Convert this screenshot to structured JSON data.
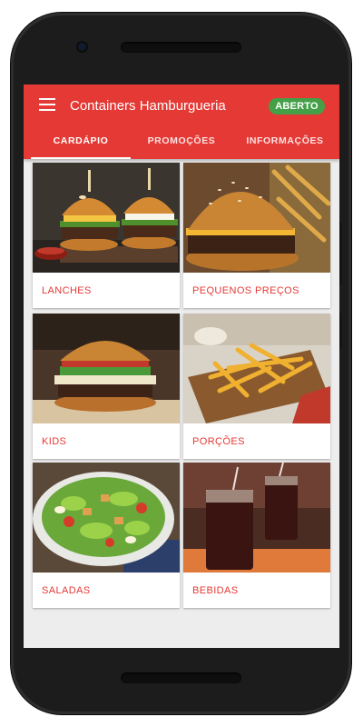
{
  "appbar": {
    "title": "Containers Hamburgueria",
    "status_badge": "ABERTO",
    "accent": "#e53935",
    "badge_color": "#43a047",
    "menu_icon": "hamburger-menu-icon"
  },
  "tabs": [
    {
      "label": "CARDÁPIO",
      "active": true
    },
    {
      "label": "PROMOÇÕES",
      "active": false
    },
    {
      "label": "INFORMAÇÕES",
      "active": false
    }
  ],
  "categories": [
    {
      "label": "LANCHES",
      "image": "burgers-photo"
    },
    {
      "label": "PEQUENOS PREÇOS",
      "image": "small-burger-photo"
    },
    {
      "label": "KIDS",
      "image": "kids-burger-photo"
    },
    {
      "label": "PORÇÕES",
      "image": "fries-photo"
    },
    {
      "label": "SALADAS",
      "image": "salad-photo"
    },
    {
      "label": "BEBIDAS",
      "image": "drinks-photo"
    }
  ]
}
